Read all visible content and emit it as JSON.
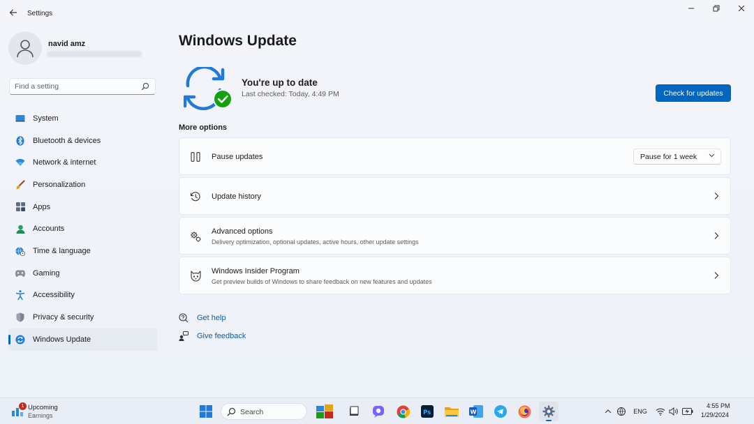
{
  "window": {
    "title": "Settings"
  },
  "profile": {
    "name": "navid amz"
  },
  "search": {
    "placeholder": "Find a setting"
  },
  "sidebar": {
    "items": [
      {
        "label": "System",
        "icon": "monitor-icon"
      },
      {
        "label": "Bluetooth & devices",
        "icon": "bluetooth-icon"
      },
      {
        "label": "Network & internet",
        "icon": "wifi-icon"
      },
      {
        "label": "Personalization",
        "icon": "brush-icon"
      },
      {
        "label": "Apps",
        "icon": "apps-icon"
      },
      {
        "label": "Accounts",
        "icon": "person-icon"
      },
      {
        "label": "Time & language",
        "icon": "globe-clock-icon"
      },
      {
        "label": "Gaming",
        "icon": "gamepad-icon"
      },
      {
        "label": "Accessibility",
        "icon": "accessibility-icon"
      },
      {
        "label": "Privacy & security",
        "icon": "shield-icon"
      },
      {
        "label": "Windows Update",
        "icon": "sync-icon",
        "active": true
      }
    ]
  },
  "main": {
    "title": "Windows Update",
    "status": {
      "title": "You're up to date",
      "subtitle": "Last checked: Today, 4:49 PM",
      "button": "Check for updates"
    },
    "more_options": "More options",
    "options": {
      "pause": {
        "title": "Pause updates",
        "select": "Pause for 1 week"
      },
      "history": {
        "title": "Update history"
      },
      "advanced": {
        "title": "Advanced options",
        "subtitle": "Delivery optimization, optional updates, active hours, other update settings"
      },
      "insider": {
        "title": "Windows Insider Program",
        "subtitle": "Get preview builds of Windows to share feedback on new features and updates"
      }
    },
    "links": {
      "help": "Get help",
      "feedback": "Give feedback"
    }
  },
  "taskbar": {
    "widget": {
      "title": "Upcoming",
      "subtitle": "Earnings",
      "badge": "1"
    },
    "search": "Search",
    "tray": {
      "language": "ENG"
    },
    "clock": {
      "time": "4:55 PM",
      "date": "1/29/2024"
    }
  },
  "colors": {
    "accent": "#0067c0",
    "success": "#13a10e",
    "link": "#0a5ea8"
  }
}
